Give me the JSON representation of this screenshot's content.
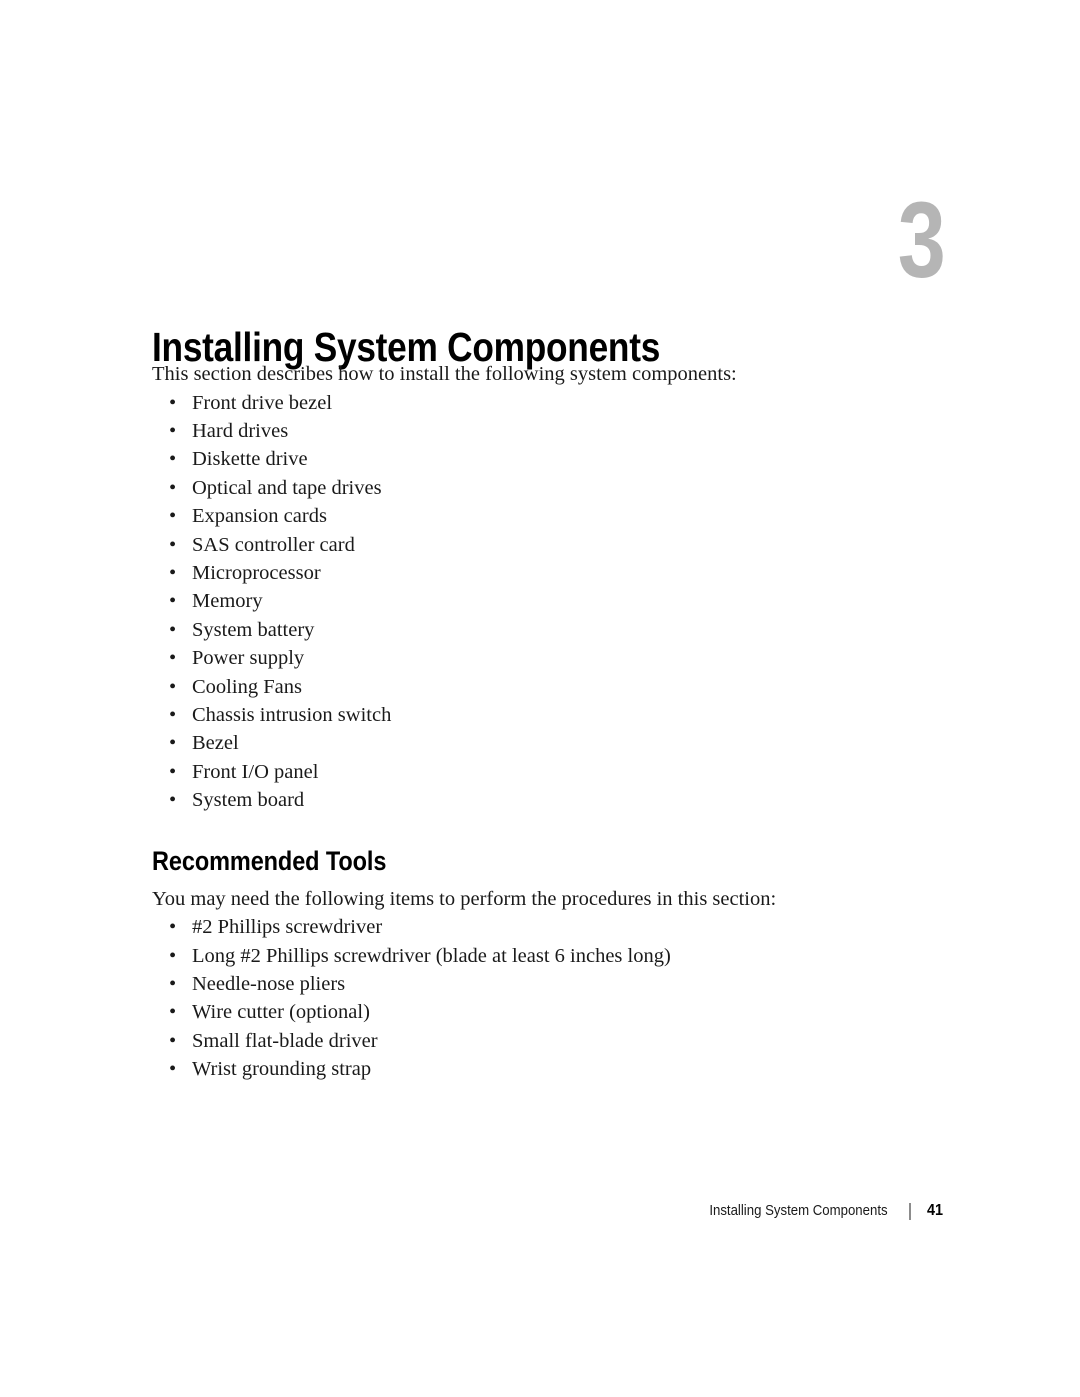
{
  "chapter": {
    "number": "3",
    "title": "Installing System Components",
    "number_color": "#b5b5b5"
  },
  "intro": {
    "text": "This section describes how to install the following system components:"
  },
  "components_list": {
    "bullet_glyph": "•",
    "items": [
      "Front drive bezel",
      "Hard drives",
      "Diskette drive",
      "Optical and tape drives",
      "Expansion cards",
      "SAS controller card",
      "Microprocessor",
      "Memory",
      "System battery",
      "Power supply",
      "Cooling Fans",
      "Chassis intrusion switch",
      "Bezel",
      "Front I/O panel",
      "System board"
    ]
  },
  "recommended_tools": {
    "heading": "Recommended Tools",
    "intro": "You may need the following items to perform the procedures in this section:",
    "bullet_glyph": "•",
    "items": [
      "#2 Phillips screwdriver",
      "Long #2 Phillips screwdriver (blade at least 6 inches long)",
      "Needle-nose pliers",
      "Wire cutter (optional)",
      "Small flat-blade driver",
      "Wrist grounding strap"
    ]
  },
  "footer": {
    "title": "Installing System Components",
    "page_number": "41"
  }
}
